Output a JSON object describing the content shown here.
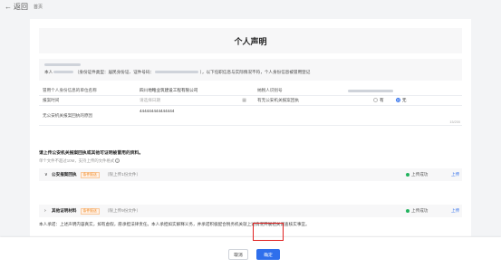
{
  "nav": {
    "back_label": "返回",
    "breadcrumb": "首页"
  },
  "page": {
    "title": "个人声明"
  },
  "declaration": {
    "line2_prefix": "本人",
    "line2_idtypes": "（身份证件类型：居民身份证、证件号码：",
    "line2_suffix": "），以下任职信息与实际情况不符，个人身份信息被冒用登记"
  },
  "table": {
    "rows": [
      {
        "k1": "冒用个人身份信息的单位名称",
        "v1": "四川地略业筑建设工程有限公司",
        "k2": "纳税人识别号"
      },
      {
        "k1": "报案时间",
        "v1_placeholder": "请选择日期",
        "k2": "有无公安机关报案回执",
        "opt_yes": "有",
        "opt_no": "无",
        "selected": "无"
      },
      {
        "k1": "无公安机关报案回执的原因",
        "v1": "444444444444444",
        "counter": "15/200"
      }
    ]
  },
  "upload": {
    "title": "请上传公安机关报案回执或其他可证明被冒用的资料。",
    "hint": "单个文件不超过10M，支持上传的文件格式",
    "items": [
      {
        "chevron": "∨",
        "name": "公安报案回执",
        "tag": "条件报送",
        "count": "（限上传1份文件）",
        "status": "上传成功",
        "action": "上传"
      },
      {
        "chevron": "›",
        "name": "其他证明材料",
        "tag": "条件报送",
        "count": "（限上传9份文件）",
        "status": "上传成功",
        "action": "上传"
      }
    ]
  },
  "promise": "本人承诺：上述声明内容真实，如有虚假，愿承担法律责任。本人承担如实解释义务，并承诺积极配合税务机关就上述情况开展相关调查核实事宜。",
  "footer": {
    "cancel_label": "取消",
    "confirm_label": "确定"
  },
  "colors": {
    "primary": "#2f6fec",
    "success": "#22b35e",
    "highlight": "#e02020",
    "tag": "#f08a24"
  }
}
